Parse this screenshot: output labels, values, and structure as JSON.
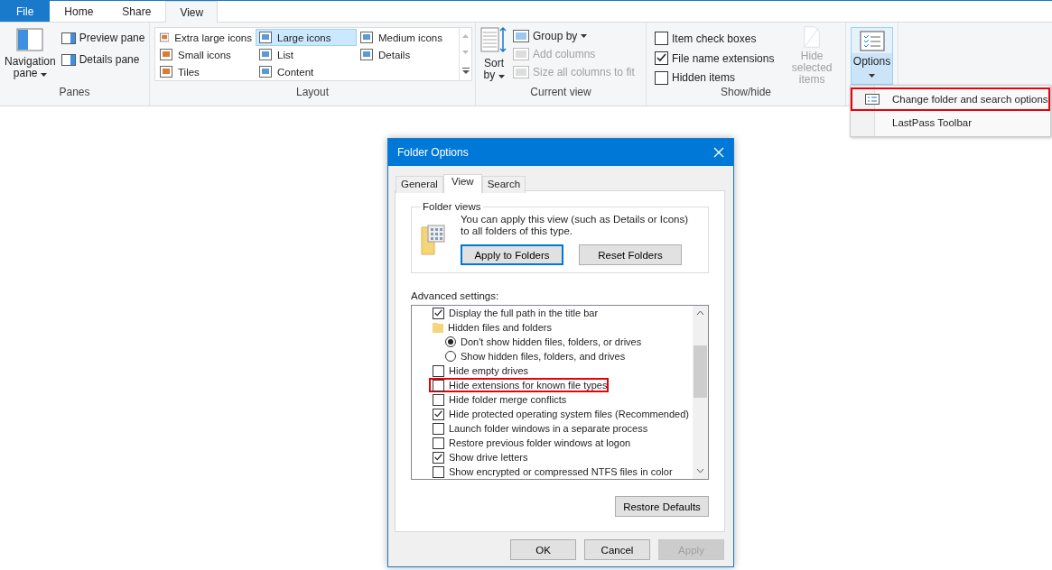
{
  "ribbon_tabs": [
    {
      "label": "File",
      "kind": "backstage",
      "selected": false
    },
    {
      "label": "Home",
      "kind": "tab",
      "selected": false
    },
    {
      "label": "Share",
      "kind": "tab",
      "selected": false
    },
    {
      "label": "View",
      "kind": "tab",
      "selected": true
    }
  ],
  "ribbon": {
    "panes": {
      "title": "Panes",
      "navigation_pane": "Navigation pane",
      "buttons": [
        "Preview pane",
        "Details pane"
      ]
    },
    "layout": {
      "title": "Layout",
      "items": [
        {
          "label": "Extra large icons",
          "selected": false
        },
        {
          "label": "Large icons",
          "selected": true
        },
        {
          "label": "Medium icons",
          "selected": false
        },
        {
          "label": "Small icons",
          "selected": false
        },
        {
          "label": "List",
          "selected": false
        },
        {
          "label": "Details",
          "selected": false
        },
        {
          "label": "Tiles",
          "selected": false
        },
        {
          "label": "Content",
          "selected": false
        }
      ]
    },
    "current_view": {
      "title": "Current view",
      "sort_by": "Sort by",
      "items": [
        {
          "label": "Group by",
          "disabled": false
        },
        {
          "label": "Add columns",
          "disabled": true
        },
        {
          "label": "Size all columns to fit",
          "disabled": true
        }
      ]
    },
    "show_hide": {
      "title": "Show/hide",
      "checkboxes": [
        {
          "label": "Item check boxes",
          "checked": false
        },
        {
          "label": "File name extensions",
          "checked": true
        },
        {
          "label": "Hidden items",
          "checked": false
        }
      ],
      "hide_selected": {
        "label": "Hide selected items",
        "disabled": true
      }
    },
    "options": {
      "label": "Options",
      "expanded": true
    }
  },
  "options_menu": [
    {
      "label": "Change folder and search options",
      "highlighted": true
    },
    {
      "label": "LastPass Toolbar",
      "highlighted": false
    }
  ],
  "dialog": {
    "title": "Folder Options",
    "tabs": [
      {
        "label": "General",
        "selected": false
      },
      {
        "label": "View",
        "selected": true
      },
      {
        "label": "Search",
        "selected": false
      }
    ],
    "folder_views": {
      "legend": "Folder views",
      "text": "You can apply this view (such as Details or Icons) to all folders of this type.",
      "buttons": [
        {
          "label": "Apply to Folders",
          "default": true
        },
        {
          "label": "Reset Folders",
          "default": false
        }
      ]
    },
    "advanced_label": "Advanced settings:",
    "settings": [
      {
        "kind": "checkbox",
        "label": "Display the full path in the title bar",
        "checked": true,
        "highlighted": false
      },
      {
        "kind": "folder",
        "label": "Hidden files and folders",
        "children": [
          {
            "kind": "radio",
            "label": "Don't show hidden files, folders, or drives",
            "selected": true
          },
          {
            "kind": "radio",
            "label": "Show hidden files, folders, and drives",
            "selected": false
          }
        ]
      },
      {
        "kind": "checkbox",
        "label": "Hide empty drives",
        "checked": false,
        "highlighted": false
      },
      {
        "kind": "checkbox",
        "label": "Hide extensions for known file types",
        "checked": false,
        "highlighted": true
      },
      {
        "kind": "checkbox",
        "label": "Hide folder merge conflicts",
        "checked": false,
        "highlighted": false
      },
      {
        "kind": "checkbox",
        "label": "Hide protected operating system files (Recommended)",
        "checked": true,
        "highlighted": false
      },
      {
        "kind": "checkbox",
        "label": "Launch folder windows in a separate process",
        "checked": false,
        "highlighted": false
      },
      {
        "kind": "checkbox",
        "label": "Restore previous folder windows at logon",
        "checked": false,
        "highlighted": false
      },
      {
        "kind": "checkbox",
        "label": "Show drive letters",
        "checked": true,
        "highlighted": false
      },
      {
        "kind": "checkbox",
        "label": "Show encrypted or compressed NTFS files in color",
        "checked": false,
        "highlighted": false
      }
    ],
    "restore_button": "Restore Defaults",
    "buttons": [
      {
        "label": "OK",
        "disabled": false
      },
      {
        "label": "Cancel",
        "disabled": false
      },
      {
        "label": "Apply",
        "disabled": true
      }
    ]
  }
}
